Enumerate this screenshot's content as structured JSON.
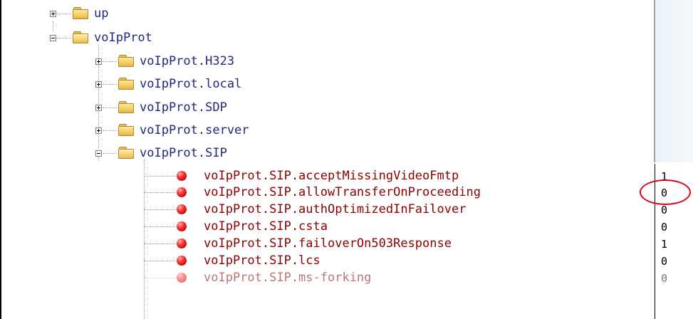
{
  "tree": {
    "folders": [
      {
        "label": "up",
        "expander": "plus"
      },
      {
        "label": "voIpProt",
        "expander": "minus"
      },
      {
        "label": "voIpProt.H323",
        "expander": "plus"
      },
      {
        "label": "voIpProt.local",
        "expander": "plus"
      },
      {
        "label": "voIpProt.SDP",
        "expander": "plus"
      },
      {
        "label": "voIpProt.server",
        "expander": "plus"
      },
      {
        "label": "voIpProt.SIP",
        "expander": "minus"
      }
    ],
    "leaves": [
      {
        "label": "voIpProt.SIP.acceptMissingVideoFmtp",
        "value": "1"
      },
      {
        "label": "voIpProt.SIP.allowTransferOnProceeding",
        "value": "0"
      },
      {
        "label": "voIpProt.SIP.authOptimizedInFailover",
        "value": "0"
      },
      {
        "label": "voIpProt.SIP.csta",
        "value": "0"
      },
      {
        "label": "voIpProt.SIP.failoverOn503Response",
        "value": "1"
      },
      {
        "label": "voIpProt.SIP.lcs",
        "value": "0"
      },
      {
        "label": "voIpProt.SIP.ms-forking",
        "value": "0"
      }
    ]
  },
  "icons": {
    "folder": "folder-icon",
    "parameter": "red-ball-icon",
    "expand": "plus-box-icon",
    "collapse": "minus-box-icon"
  },
  "colors": {
    "folder_text": "#1f2a7a",
    "leaf_text": "#8b0000",
    "highlight": "#e0001a"
  }
}
